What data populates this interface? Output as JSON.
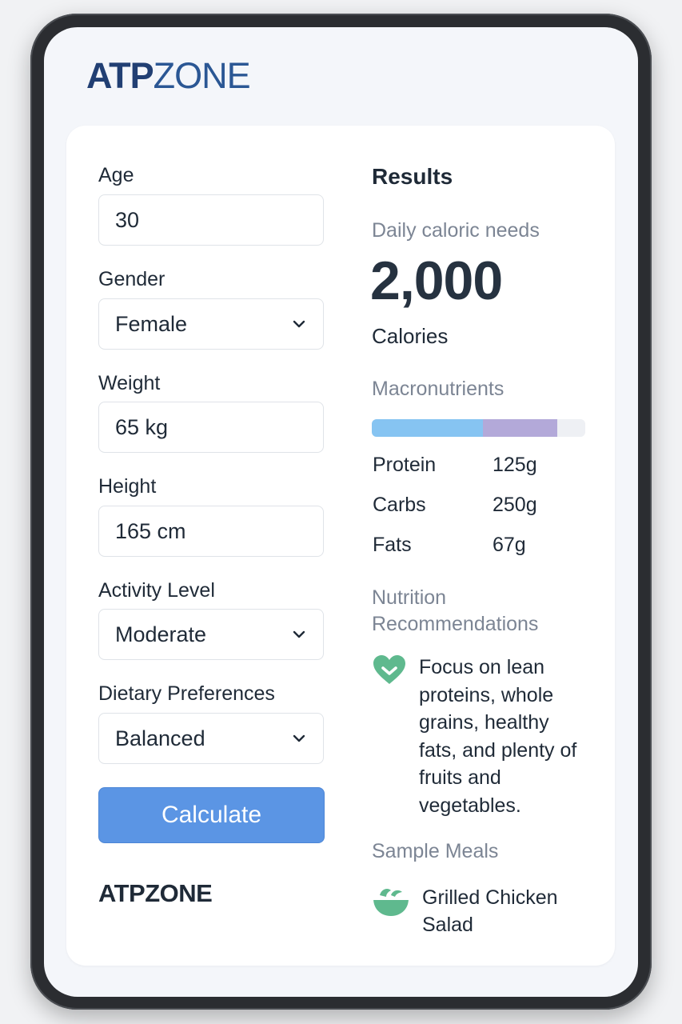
{
  "app": {
    "logo_bold": "ATP",
    "logo_regular": "ZONE",
    "footer_brand": "ATPZONE"
  },
  "form": {
    "age_label": "Age",
    "age_value": "30",
    "gender_label": "Gender",
    "gender_value": "Female",
    "weight_label": "Weight",
    "weight_value": "65 kg",
    "height_label": "Height",
    "height_value": "165 cm",
    "activity_label": "Activity Level",
    "activity_value": "Moderate",
    "diet_label": "Dietary Preferences",
    "diet_value": "Balanced",
    "calculate_label": "Calculate"
  },
  "results": {
    "title": "Results",
    "daily_label": "Daily caloric needs",
    "calories_value": "2,000",
    "calories_unit": "Calories",
    "macros_label": "Macronutrients",
    "macros_bar": {
      "protein_fraction": 0.52,
      "carbs_fraction": 0.35
    },
    "macros": [
      {
        "name": "Protein",
        "value": "125g"
      },
      {
        "name": "Carbs",
        "value": "250g"
      },
      {
        "name": "Fats",
        "value": "67g"
      }
    ],
    "recommendations_label_line1": "Nutrition",
    "recommendations_label_line2": "Recommendations",
    "recommendation_text": "Focus on lean proteins, whole grains, healthy fats, and plenty of fruits and vegetables.",
    "sample_meals_label": "Sample Meals",
    "sample_meal": "Grilled Chicken Salad"
  },
  "icons": {
    "recommendation": "heart-check-icon",
    "meal": "salad-bowl-icon",
    "select": "chevron-down-icon"
  },
  "colors": {
    "accent": "#5b95e4",
    "brand": "#213f73",
    "protein": "#86c4f2",
    "carbs": "#b3a9d9",
    "icon_green": "#5fb98e"
  }
}
